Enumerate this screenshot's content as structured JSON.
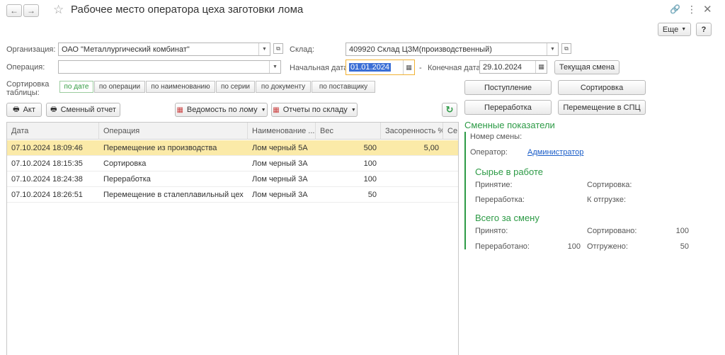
{
  "window": {
    "title": "Рабочее место оператора цеха заготовки лома",
    "more_label": "Еще",
    "help_label": "?"
  },
  "form": {
    "org_label": "Организация:",
    "org_value": "ОАО \"Металлургический комбинат\"",
    "warehouse_label": "Склад:",
    "warehouse_value": "409920 Склад ЦЗМ(производственный)",
    "operation_label": "Операция:",
    "operation_value": "",
    "start_date_label": "Начальная дата:",
    "start_date_value": "01.01.2024",
    "dash": "-",
    "end_date_label": "Конечная дата:",
    "end_date_value": "29.10.2024",
    "current_shift_label": "Текущая смена"
  },
  "sorting": {
    "label": "Сортировка таблицы:",
    "options": [
      "по дате",
      "по операции",
      "по наименованию",
      "по серии",
      "по документу",
      "по поставщику"
    ],
    "active": "по дате"
  },
  "actions": {
    "act_label": "Акт",
    "shift_report_label": "Сменный отчет",
    "scrap_statement_label": "Ведомость по лому",
    "warehouse_reports_label": "Отчеты по складу"
  },
  "right_buttons": {
    "receipt": "Поступление",
    "sorting": "Сортировка",
    "processing": "Переработка",
    "transfer": "Перемещение в СПЦ"
  },
  "table": {
    "columns": [
      "Дата",
      "Операция",
      "Наименование ...",
      "Вес",
      "Засоренность %",
      "Се"
    ],
    "rows": [
      {
        "date": "07.10.2024 18:09:46",
        "operation": "Перемещение из производства",
        "name": "Лом черный 5А",
        "weight": "500",
        "contamination": "5,00"
      },
      {
        "date": "07.10.2024 18:15:35",
        "operation": "Сортировка",
        "name": "Лом черный 3А",
        "weight": "100",
        "contamination": ""
      },
      {
        "date": "07.10.2024 18:24:38",
        "operation": "Переработка",
        "name": "Лом черный 3А",
        "weight": "100",
        "contamination": ""
      },
      {
        "date": "07.10.2024 18:26:51",
        "operation": "Перемещение в сталеплавильный цех",
        "name": "Лом черный 3А",
        "weight": "50",
        "contamination": ""
      }
    ]
  },
  "shift": {
    "title": "Сменные показатели",
    "shift_number_label": "Номер смены:",
    "shift_number_value": "",
    "operator_label": "Оператор:",
    "operator_value": "Администратор",
    "raw_title": "Сырье в работе",
    "intake_label": "Принятие:",
    "intake_value": "",
    "sorting_label": "Сортировка:",
    "sorting_value": "",
    "processing_label": "Переработка:",
    "processing_value": "",
    "to_ship_label": "К отгрузке:",
    "to_ship_value": "",
    "total_title": "Всего за смену",
    "accepted_label": "Принято:",
    "accepted_value": "",
    "sorted_label": "Сортировано:",
    "sorted_value": "100",
    "processed_label": "Переработано:",
    "processed_value": "100",
    "shipped_label": "Отгружено:",
    "shipped_value": "50"
  },
  "colors": {
    "accent_green": "#2c9a45",
    "selected_row": "#fbeaa8",
    "link_blue": "#1a5dc8"
  }
}
